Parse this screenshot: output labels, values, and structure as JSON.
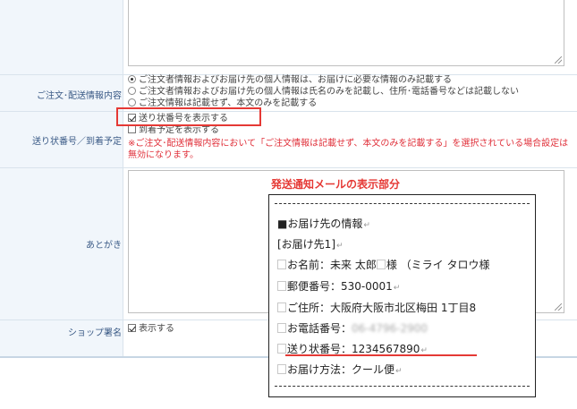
{
  "form": {
    "rows": {
      "order_info": {
        "label": "ご注文･配送情報内容",
        "options": [
          "ご注文者情報およびお届け先の個人情報は、お届けに必要な情報のみ記載する",
          "ご注文者情報およびお届け先の個人情報は氏名のみを記載し、住所･電話番号などは記載しない",
          "ご注文情報は記載せず、本文のみを記載する"
        ],
        "selected_index": 0
      },
      "tracking": {
        "label": "送り状番号／到着予定",
        "checkbox_tracking": "送り状番号を表示する",
        "checkbox_arrival": "到着予定を表示する",
        "note": "※ご注文･配送情報内容において「ご注文情報は記載せず、本文のみを記載する」を選択されている場合設定は無効になります。"
      },
      "closing": {
        "label": "あとがき"
      },
      "signature": {
        "label": "ショップ署名",
        "checkbox": "表示する"
      }
    }
  },
  "overlay": {
    "title": "発送通知メールの表示部分",
    "mail_lines": [
      {
        "text": "■お届け先の情報",
        "ret": true
      },
      {
        "text": "[お届け先1]",
        "ret": true
      },
      {
        "prefix": "お名前：",
        "value": "未来 太郎",
        "suffix": "様 （ミライ タロウ様"
      },
      {
        "prefix": "郵便番号：",
        "value": "530-0001",
        "ret": true
      },
      {
        "prefix": "ご住所：",
        "value": "大阪府大阪市北区梅田 1丁目8"
      },
      {
        "prefix": "お電話番号：",
        "value": "06-4796-2900",
        "blurred": true
      },
      {
        "prefix": "送り状番号：",
        "value": "1234567890",
        "ret": true
      },
      {
        "prefix": "お届け方法：",
        "value": "クール便",
        "ret": true
      }
    ],
    "return_mark": "↵"
  },
  "colors": {
    "accent_red": "#e53935",
    "label_bg": "#f1f6fb",
    "label_text": "#3a5a86",
    "note_red": "#e0303a"
  }
}
